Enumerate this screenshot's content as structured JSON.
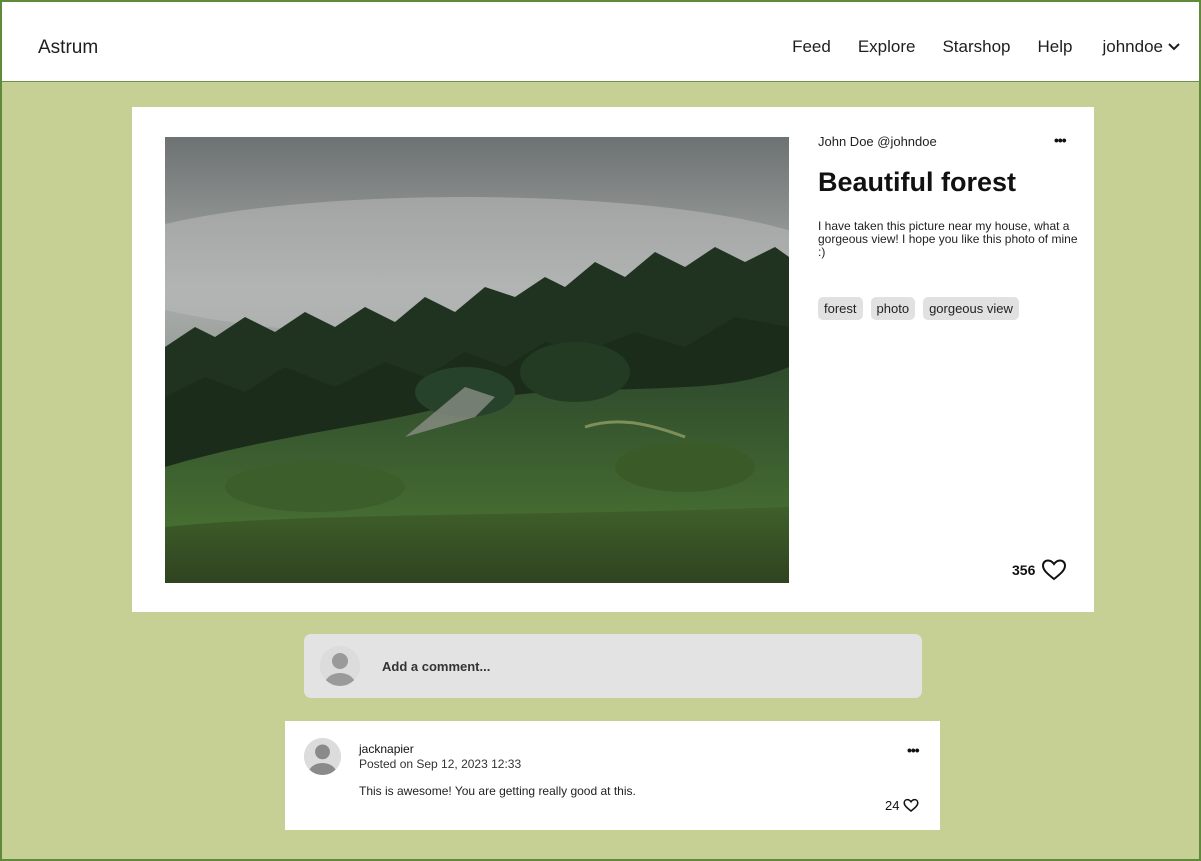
{
  "header": {
    "brand": "Astrum",
    "nav": [
      "Feed",
      "Explore",
      "Starshop",
      "Help"
    ],
    "username": "johndoe"
  },
  "post": {
    "author": "John Doe @johndoe",
    "more": "•••",
    "title": "Beautiful forest",
    "description": "I have taken this picture near my house, what a gorgeous view! I hope you like this photo of mine :)",
    "tags": [
      "forest",
      "photo",
      "gorgeous view"
    ],
    "likes": "356"
  },
  "add_comment": {
    "placeholder": "Add a comment..."
  },
  "comments": [
    {
      "user": "jacknapier",
      "date": "Posted on Sep 12, 2023 12:33",
      "text": "This is awesome! You are getting really good at this.",
      "likes": "24",
      "more": "•••"
    }
  ],
  "colors": {
    "background": "#c6d094",
    "card": "#ffffff",
    "tag": "#e1e1e1",
    "comment_box": "#e3e3e3"
  }
}
